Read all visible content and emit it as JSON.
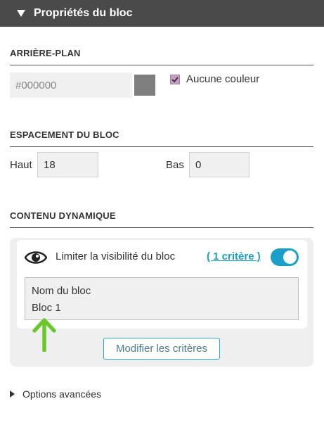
{
  "header": {
    "title": "Propriétés du bloc"
  },
  "background": {
    "section_title": "ARRIÈRE-PLAN",
    "color_value": "#000000",
    "swatch_color": "#7f7f7f",
    "no_color_label": "Aucune couleur",
    "no_color_checked": true
  },
  "spacing": {
    "section_title": "ESPACEMENT DU BLOC",
    "top_label": "Haut",
    "top_value": "18",
    "bottom_label": "Bas",
    "bottom_value": "0"
  },
  "dynamic": {
    "section_title": "CONTENU DYNAMIQUE",
    "visibility_label": "Limiter la visibilité du bloc",
    "criteria_link": "( 1 critère )",
    "toggle_on": true,
    "criteria_lines": [
      "Nom du bloc",
      "Bloc 1"
    ],
    "modify_button": "Modifier les critères"
  },
  "advanced": {
    "label": "Options avancées"
  },
  "colors": {
    "accent": "#1aa0c8",
    "header_bg": "#4a4a4a",
    "checkbox": "#c89cc3",
    "arrow": "#6cc72c"
  }
}
